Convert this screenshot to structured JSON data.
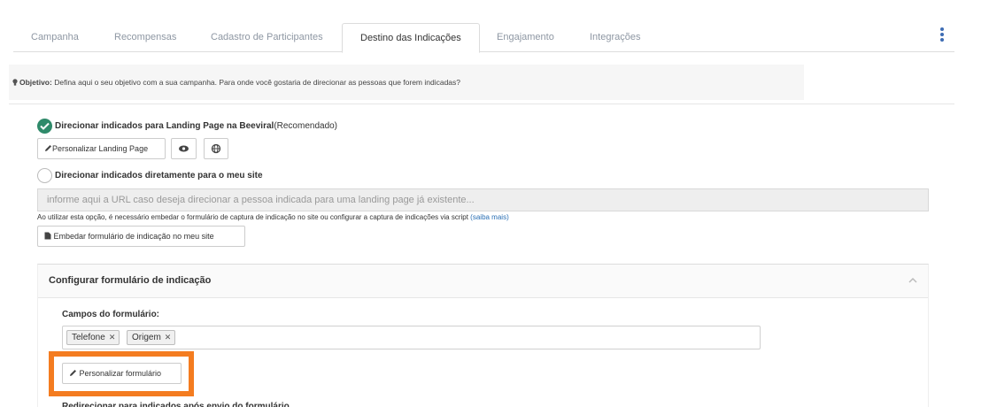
{
  "tabs": [
    {
      "label": "Campanha"
    },
    {
      "label": "Recompensas"
    },
    {
      "label": "Cadastro de Participantes"
    },
    {
      "label": "Destino das Indicações",
      "active": true
    },
    {
      "label": "Engajamento"
    },
    {
      "label": "Integrações"
    }
  ],
  "objective": {
    "label": "Objetivo:",
    "text": " Defina aqui o seu objetivo com a sua campanha. Para onde você gostaria de direcionar as pessoas que forem indicadas?"
  },
  "option_landing": {
    "label": "Direcionar indicados para Landing Page na Beeviral",
    "suffix": "(Recomendado)",
    "selected": true,
    "customize_button": "Personalizar Landing Page"
  },
  "option_site": {
    "label": "Direcionar indicados diretamente para o meu site",
    "selected": false,
    "url_placeholder": "informe aqui a URL caso deseja direcionar a pessoa indicada para uma landing page já existente...",
    "note": "Ao utilizar esta opção, é necessário embedar o formulário de captura de indicação no site ou configurar a captura de indicações via script ",
    "note_link": "(saiba mais)",
    "embed_button": "Embedar formulário de indicação no meu site"
  },
  "form_config": {
    "title": "Configurar formulário de indicação",
    "fields_label": "Campos do formulário:",
    "fields": [
      "Telefone",
      "Origem"
    ],
    "customize_button": "Personalizar formulário",
    "cut_text": "Redirecionar para indicados após envio do formulário"
  },
  "colors": {
    "accent": "#3e6cb4",
    "check": "#2f8a6a",
    "highlight": "#f47c20",
    "link": "#2a6fb4"
  }
}
